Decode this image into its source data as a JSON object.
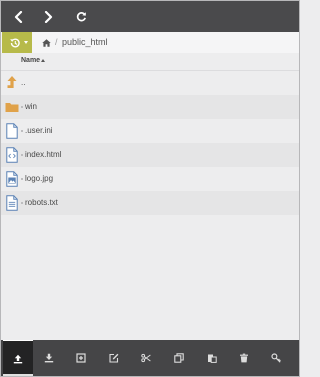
{
  "nav": {
    "back_icon": "chevron-left-icon",
    "forward_icon": "chevron-right-icon",
    "refresh_icon": "refresh-icon"
  },
  "breadcrumb": {
    "history_icon": "history-icon",
    "home_icon": "home-icon",
    "separator": "/",
    "path": "public_html"
  },
  "list_header": {
    "name_label": "Name"
  },
  "files": [
    {
      "name": "..",
      "type": "parent",
      "icon": "up-arrow-icon"
    },
    {
      "name": "win",
      "type": "folder",
      "icon": "folder-icon"
    },
    {
      "name": ".user.ini",
      "type": "file",
      "icon": "file-icon"
    },
    {
      "name": "index.html",
      "type": "code",
      "icon": "code-file-icon"
    },
    {
      "name": "logo.jpg",
      "type": "image",
      "icon": "image-file-icon"
    },
    {
      "name": "robots.txt",
      "type": "text",
      "icon": "text-file-icon"
    }
  ],
  "toolbar": [
    {
      "name": "upload",
      "icon": "upload-icon",
      "active": true
    },
    {
      "name": "download",
      "icon": "download-icon"
    },
    {
      "name": "new",
      "icon": "add-icon"
    },
    {
      "name": "edit",
      "icon": "edit-icon"
    },
    {
      "name": "cut",
      "icon": "cut-icon"
    },
    {
      "name": "copy",
      "icon": "copy-icon"
    },
    {
      "name": "paste",
      "icon": "paste-icon"
    },
    {
      "name": "delete",
      "icon": "trash-icon"
    },
    {
      "name": "permissions",
      "icon": "key-icon"
    }
  ],
  "colors": {
    "nav_bg": "#4a4a4c",
    "history_accent": "#b7ba4a",
    "folder": "#e0a24a",
    "file_icon": "#5b82b5",
    "toolbar_bg": "#454547"
  }
}
